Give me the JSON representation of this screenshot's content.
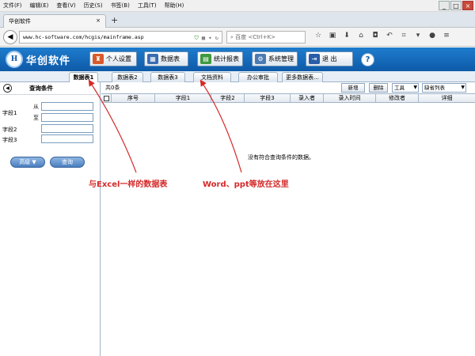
{
  "browser": {
    "menu": [
      "文件(F)",
      "编辑(E)",
      "查看(V)",
      "历史(S)",
      "书签(B)",
      "工具(T)",
      "帮助(H)"
    ],
    "tab_title": "华创软件",
    "tab_close": "×",
    "new_tab": "+",
    "url": "www.hc-software.com/hcgis/mainframe.asp",
    "search_placeholder": "百度 <Ctrl+K>",
    "window_controls": [
      "_",
      "□",
      "×"
    ]
  },
  "app": {
    "logo_mark": "H",
    "logo_text": "华创软件",
    "header_buttons": [
      {
        "label": "个人设置",
        "icon": "person-icon"
      },
      {
        "label": "数据表",
        "icon": "table-icon"
      },
      {
        "label": "统计报表",
        "icon": "report-icon"
      },
      {
        "label": "系统管理",
        "icon": "gear-icon"
      },
      {
        "label": "退 出",
        "icon": "exit-icon"
      }
    ],
    "help_label": "?",
    "tabs": [
      "数据表1",
      "数据表2",
      "数据表3",
      "文档资料",
      "办公审批",
      "更多数据表..."
    ],
    "query_panel": {
      "title": "查询条件",
      "fields": [
        "字段1",
        "字段2",
        "字段3"
      ],
      "from_label": "从",
      "to_label": "至",
      "advanced_label": "高级 ▼",
      "query_label": "查询"
    },
    "grid": {
      "count": "共0条",
      "new_label": "新增",
      "delete_label": "删除",
      "tools_label": "工具",
      "view_label": "缺省列表",
      "columns": [
        "序号",
        "字段1",
        "字段2",
        "字段3",
        "录入者",
        "录入时间",
        "修改者",
        "详细"
      ],
      "empty_message": "没有符合查询条件的数据。"
    }
  },
  "annotations": {
    "left": "与Excel一样的数据表",
    "right": "Word、ppt等放在这里"
  },
  "colors": {
    "header_blue": "#1270c4",
    "annotation_red": "#d42a2a"
  }
}
